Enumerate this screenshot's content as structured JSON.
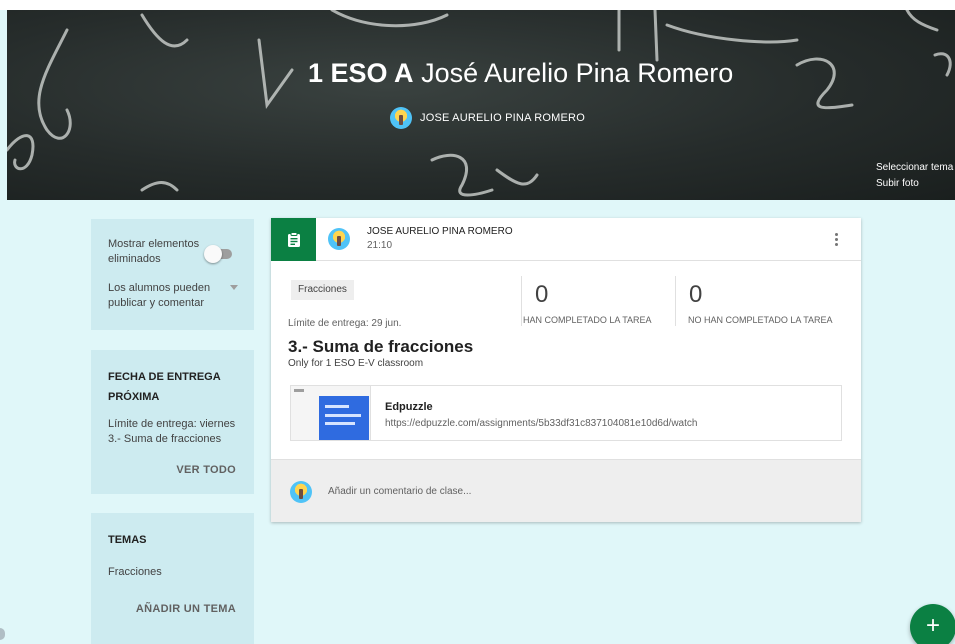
{
  "banner": {
    "class_name": "1 ESO A",
    "teacher_full": "José Aurelio Pina Romero",
    "teacher_upper": "JOSE AURELIO PINA ROMERO",
    "select_theme": "Seleccionar tema",
    "upload_photo": "Subir foto"
  },
  "sidebar": {
    "show_deleted": "Mostrar elementos eliminados",
    "students_permission": "Los alumnos pueden publicar y comentar",
    "upcoming_heading": "FECHA DE ENTREGA PRÓXIMA",
    "upcoming_due": "Límite de entrega: viernes",
    "upcoming_item": "3.- Suma de fracciones",
    "view_all": "VER TODO",
    "topics_heading": "TEMAS",
    "topic_1": "Fracciones",
    "add_topic": "AÑADIR UN TEMA"
  },
  "post": {
    "author": "JOSE AURELIO PINA ROMERO",
    "time": "21:10",
    "topic": "Fracciones",
    "due": "Límite de entrega: 29 jun.",
    "completed_count": "0",
    "completed_label": "HAN COMPLETADO LA TAREA",
    "not_completed_count": "0",
    "not_completed_label": "NO HAN COMPLETADO LA TAREA",
    "title": "3.- Suma de fracciones",
    "description": "Only for 1 ESO E-V classroom",
    "attachment": {
      "title": "Edpuzzle",
      "url": "https://edpuzzle.com/assignments/5b33df31c837104081e10d6d/watch"
    },
    "comment_placeholder": "Añadir un comentario de clase..."
  },
  "fab_label": "+",
  "colors": {
    "accent": "#0b8043",
    "page_bg": "#e0f7f9",
    "sidebar_bg": "#cdebf0",
    "banner_bg": "#262c2b"
  },
  "icons": [
    "assignment-icon",
    "more-vert-icon",
    "dropdown-icon",
    "add-icon"
  ]
}
